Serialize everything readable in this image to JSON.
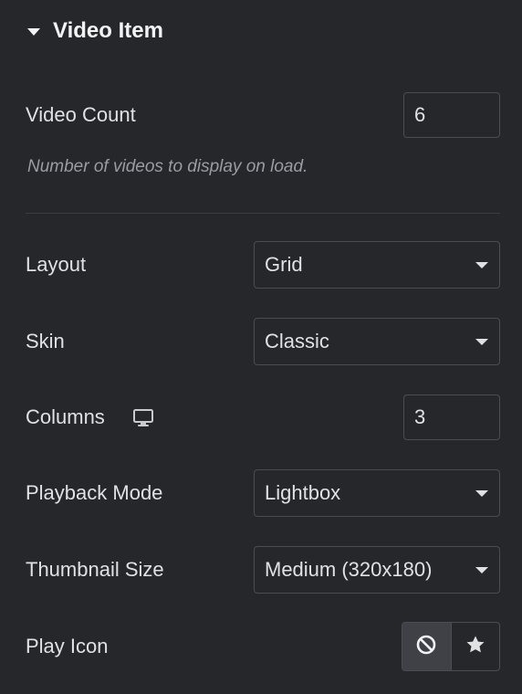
{
  "section": {
    "title": "Video Item",
    "collapse_icon": "caret-down-icon"
  },
  "video_count": {
    "label": "Video Count",
    "value": "6",
    "help": "Number of videos to display on load."
  },
  "layout": {
    "label": "Layout",
    "value": "Grid"
  },
  "skin": {
    "label": "Skin",
    "value": "Classic"
  },
  "columns": {
    "label": "Columns",
    "device_icon": "desktop-icon",
    "value": "3"
  },
  "playback_mode": {
    "label": "Playback Mode",
    "value": "Lightbox"
  },
  "thumbnail_size": {
    "label": "Thumbnail Size",
    "value": "Medium (320x180)"
  },
  "play_icon": {
    "label": "Play Icon",
    "options": [
      {
        "icon": "ban-icon",
        "selected": true
      },
      {
        "icon": "star-icon",
        "selected": false
      }
    ]
  },
  "colors": {
    "background": "#26272b",
    "border": "#4b4d53",
    "text": "#e0e1e3",
    "muted": "#9a9ca2",
    "active_choice": "#3f4147"
  }
}
